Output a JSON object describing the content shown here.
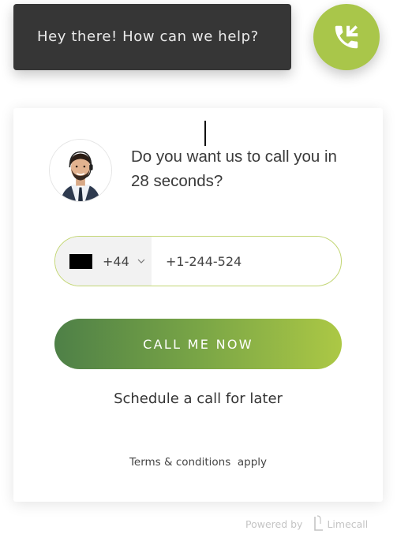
{
  "tooltip": {
    "text": "Hey there! How can we help?"
  },
  "fab": {
    "icon": "phone-incoming-icon",
    "color": "#a9c64a"
  },
  "card": {
    "question": "Do you want us to call you in 28 seconds?",
    "phone": {
      "dial_code": "+44",
      "number": "+1-244-524",
      "flag_color": "#000000"
    },
    "call_button_label": "CALL ME NOW",
    "schedule_label": "Schedule a call for later",
    "terms_link": "Terms & conditions",
    "terms_suffix": "apply"
  },
  "footer": {
    "powered_by": "Powered by",
    "brand": "Limecall"
  },
  "colors": {
    "accent": "#a9c64a",
    "gradient_start": "#4e8047",
    "gradient_end": "#acc845",
    "tooltip_bg": "#363636",
    "field_border": "#c3d675"
  }
}
